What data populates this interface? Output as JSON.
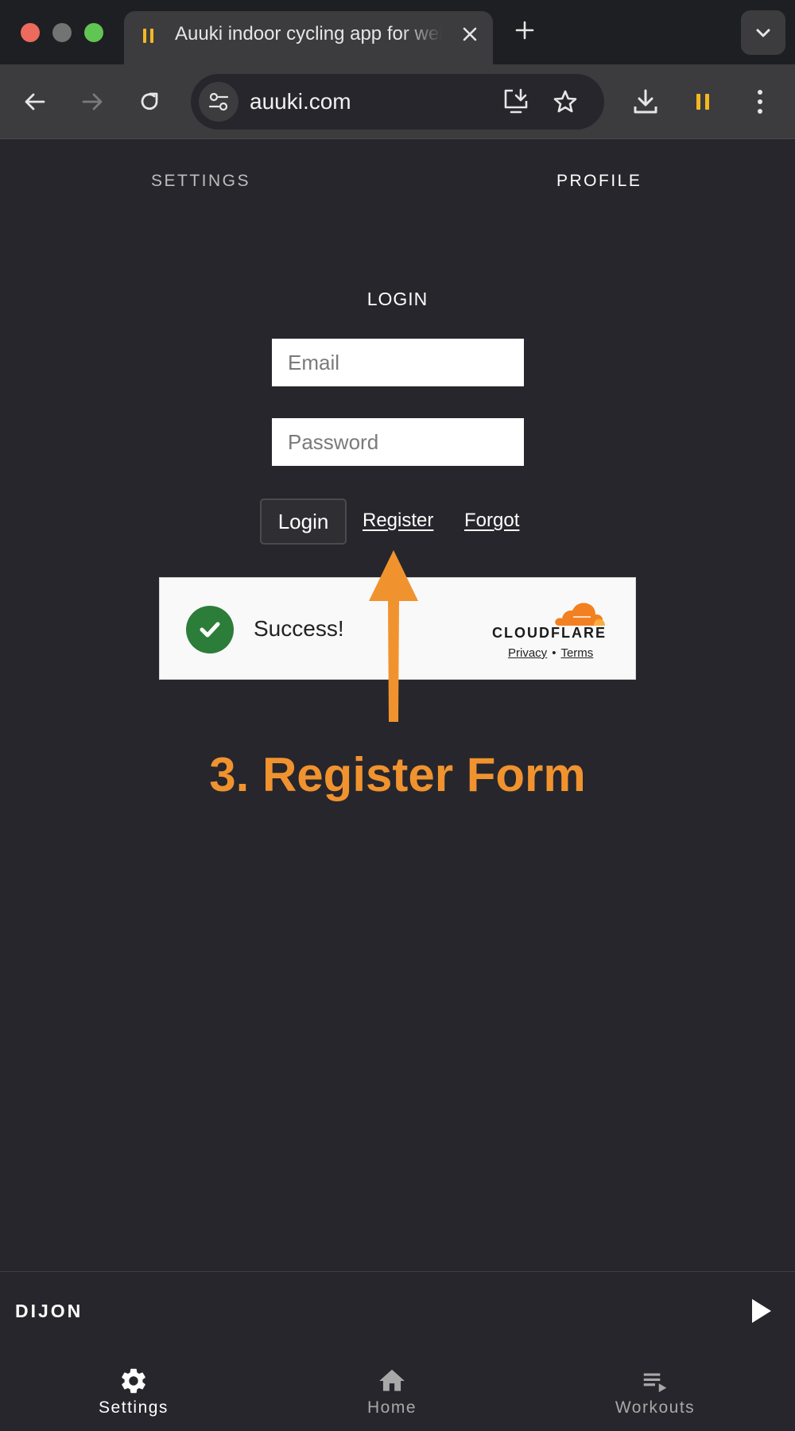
{
  "browser": {
    "tab_title": "Auuki indoor cycling app for web",
    "url": "auuki.com",
    "colors": {
      "tab_indicator": "#f2b824"
    }
  },
  "nav": {
    "settings": "SETTINGS",
    "profile": "PROFILE"
  },
  "login": {
    "title": "LOGIN",
    "email_placeholder": "Email",
    "email_value": "",
    "password_placeholder": "Password",
    "password_value": "",
    "login_button": "Login",
    "register_link": "Register",
    "forgot_link": "Forgot"
  },
  "captcha": {
    "status": "Success!",
    "brand": "CLOUDFLARE",
    "privacy": "Privacy",
    "separator": "•",
    "terms": "Terms",
    "colors": {
      "check": "#2c7d3a",
      "brand": "#f38020"
    }
  },
  "annotation": {
    "text": "3. Register Form",
    "color": "#f0932f"
  },
  "player": {
    "name": "DIJON"
  },
  "bottom_nav": [
    {
      "label": "Settings",
      "icon": "gear-icon",
      "active": true
    },
    {
      "label": "Home",
      "icon": "home-icon",
      "active": false
    },
    {
      "label": "Workouts",
      "icon": "playlist-icon",
      "active": false
    }
  ]
}
